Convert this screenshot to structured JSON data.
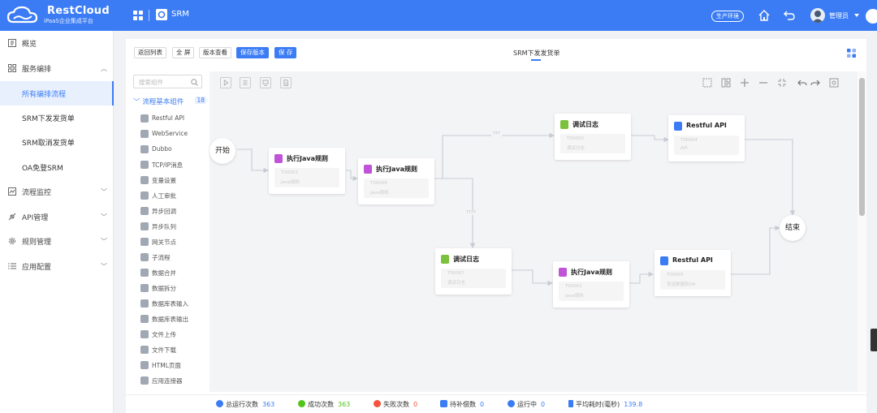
{
  "brand": {
    "name": "RestCloud",
    "subtitle": "iPaaS企业集成平台"
  },
  "header": {
    "app_title": "SRM",
    "env_badge": "生产环境",
    "user_name": "管理员"
  },
  "sidebar": {
    "items": [
      {
        "label": "概览",
        "icon": "overview-icon",
        "expandable": false
      },
      {
        "label": "服务编排",
        "icon": "orchestration-icon",
        "expandable": true,
        "expanded": true
      },
      {
        "label": "流程监控",
        "icon": "monitor-icon",
        "expandable": true
      },
      {
        "label": "API管理",
        "icon": "api-icon",
        "expandable": true
      },
      {
        "label": "规则管理",
        "icon": "gear-icon",
        "expandable": true
      },
      {
        "label": "应用配置",
        "icon": "list-icon",
        "expandable": true
      }
    ],
    "sub_items": [
      {
        "label": "所有编排流程",
        "active": true
      },
      {
        "label": "SRM下发发货单",
        "active": false
      },
      {
        "label": "SRM取消发货单",
        "active": false
      },
      {
        "label": "OA免登SRM",
        "active": false
      }
    ]
  },
  "toolbar": {
    "back_label": "返回列表",
    "fullscreen_label": "全 屏",
    "version_view_label": "版本查看",
    "save_version_label": "保存版本",
    "save_label": "保 存"
  },
  "flow_title": "SRM下发发货单",
  "palette": {
    "search_placeholder": "搜索组件",
    "group_label": "流程基本组件",
    "group_count": "18",
    "items": [
      "Restful API",
      "WebService",
      "Dubbo",
      "TCP/IP消息",
      "变量设置",
      "人工审批",
      "异步回调",
      "异步队列",
      "网关节点",
      "子流程",
      "数据合并",
      "数据拆分",
      "数据库表输入",
      "数据库表输出",
      "文件上传",
      "文件下载",
      "HTML页面",
      "应用连接器"
    ]
  },
  "canvas": {
    "start_label": "开始",
    "end_label": "结束",
    "edge_labels": [
      "???",
      "????"
    ],
    "nodes": [
      {
        "title": "执行Java规则",
        "line1": "T00002",
        "line2": "Java规则",
        "icon_color": "#c053d8"
      },
      {
        "title": "执行Java规则",
        "line1": "T00006",
        "line2": "Java规则",
        "icon_color": "#c053d8"
      },
      {
        "title": "调试日志",
        "line1": "T00003",
        "line2": "调试日志",
        "icon_color": "#7cc13c"
      },
      {
        "title": "Restful API",
        "line1": "T00004",
        "line2": "API",
        "icon_color": "#3b7cf5"
      },
      {
        "title": "调试日志",
        "line1": "T00007",
        "line2": "调试日志",
        "icon_color": "#7cc13c"
      },
      {
        "title": "执行Java规则",
        "line1": "T00001",
        "line2": "Java规则",
        "icon_color": "#c053d8"
      },
      {
        "title": "Restful API",
        "line1": "T00005",
        "line2": "发送数据到OA",
        "icon_color": "#3b7cf5"
      }
    ]
  },
  "stats": [
    {
      "label": "总运行次数",
      "value": "363",
      "color": "#3b7cf5",
      "value_color": "#3b7cf5"
    },
    {
      "label": "成功次数",
      "value": "363",
      "color": "#52c41a",
      "value_color": "#52c41a"
    },
    {
      "label": "失败次数",
      "value": "0",
      "color": "#f5533d",
      "value_color": "#f5533d"
    },
    {
      "label": "待补偿数",
      "value": "0",
      "color": "#3b7cf5",
      "value_color": "#3b7cf5"
    },
    {
      "label": "运行中",
      "value": "0",
      "color": "#3b7cf5",
      "value_color": "#3b7cf5"
    },
    {
      "label": "平均耗时(毫秒)",
      "value": "139.8",
      "color": "#3b7cf5",
      "value_color": "#3b7cf5"
    }
  ]
}
